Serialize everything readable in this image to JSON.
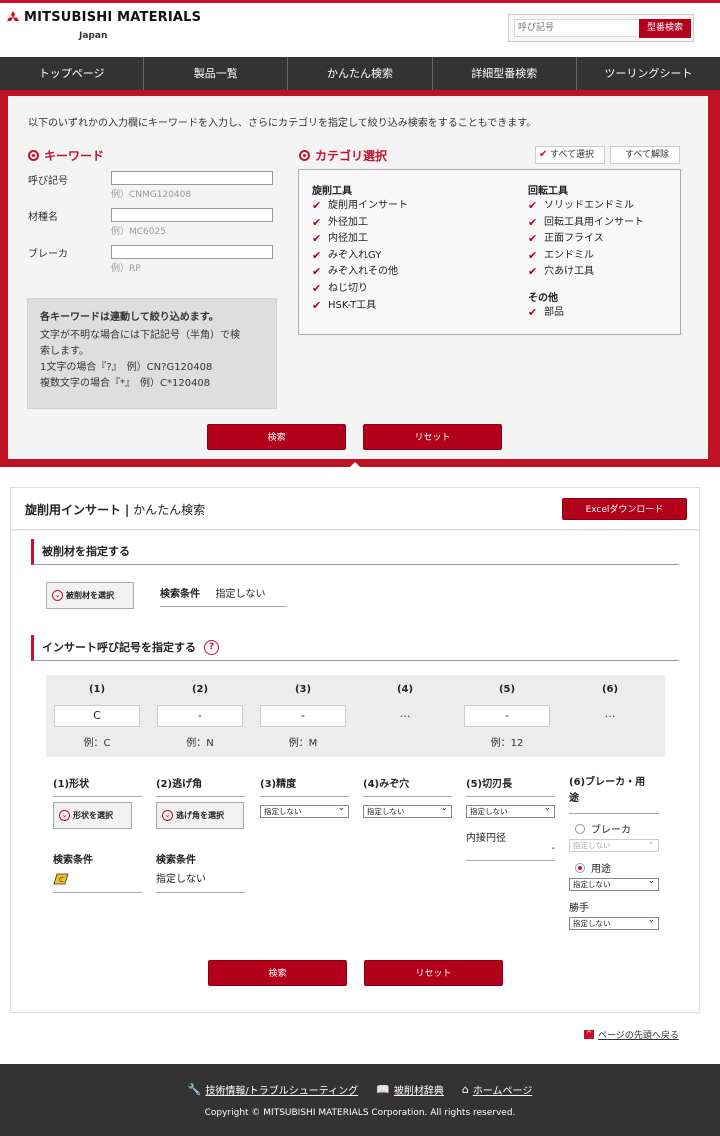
{
  "header": {
    "logo_text": "MITSUBISHI MATERIALS",
    "logo_sub": "Japan",
    "search_placeholder": "呼び記号",
    "search_button": "型番検索"
  },
  "nav": [
    "トップページ",
    "製品一覧",
    "かんたん検索",
    "詳細型番検索",
    "ツーリングシート"
  ],
  "search_panel": {
    "intro": "以下のいずれかの入力欄にキーワードを入力し、さらにカテゴリを指定して絞り込み検索をすることもできます。",
    "keyword_heading": "キーワード",
    "fields": [
      {
        "label": "呼び記号",
        "example": "例）CNMG120408"
      },
      {
        "label": "材種名",
        "example": "例）MC6025"
      },
      {
        "label": "ブレーカ",
        "example": "例）RP"
      }
    ],
    "note": {
      "title": "各キーワードは連動して絞り込めます。",
      "line1": "文字が不明な場合には下記記号（半角）で検",
      "line2": "索します。",
      "line3": "1文字の場合『?』　例）CN?G120408",
      "line4": "複数文字の場合『*』　例）C*120408"
    },
    "category_heading": "カテゴリ選択",
    "select_all": "すべて選択",
    "deselect_all": "すべて解除",
    "turning_title": "旋削工具",
    "turning_items": [
      "旋削用インサート",
      "外径加工",
      "内径加工",
      "みぞ入れGY",
      "みぞ入れその他",
      "ねじ切り",
      "HSK-T工具"
    ],
    "rotating_title": "回転工具",
    "rotating_items": [
      "ソリッドエンドミル",
      "回転工具用インサート",
      "正面フライス",
      "エンドミル",
      "穴あけ工具"
    ],
    "other_title": "その他",
    "other_items": [
      "部品"
    ],
    "search_button": "検索",
    "reset_button": "リセット"
  },
  "results": {
    "title_bold": "旋削用インサート",
    "title_sep": "|",
    "title_rest": "かんたん検索",
    "excel_button": "Excelダウンロード",
    "work_heading": "被削材を指定する",
    "work_select_button": "被削材を選択",
    "work_cond_label": "検索条件",
    "work_cond_value": "指定しない",
    "insert_heading": "インサート呼び記号を指定する",
    "help_icon": "?",
    "code_columns": [
      {
        "num": "(1)",
        "value": "C",
        "example": "例：C"
      },
      {
        "num": "(2)",
        "value": "-",
        "example": "例：N"
      },
      {
        "num": "(3)",
        "value": "-",
        "example": "例：M"
      },
      {
        "num": "(4)",
        "value": "…",
        "example": ""
      },
      {
        "num": "(5)",
        "value": "-",
        "example": "例：12"
      },
      {
        "num": "(6)",
        "value": "…",
        "example": ""
      }
    ],
    "f1_head": "(1)形状",
    "f1_button": "形状を選択",
    "f1_cond_label": "検索条件",
    "f1_cond_icon": "C",
    "f2_head": "(2)逃げ角",
    "f2_button": "逃げ角を選択",
    "f2_cond_label": "検索条件",
    "f2_cond_value": "指定しない",
    "f3_head": "(3)精度",
    "f3_select": "指定しない",
    "f4_head": "(4)みぞ穴",
    "f4_select": "指定しない",
    "f5_head": "(5)切刃長",
    "f5_select": "指定しない",
    "f5_sub_label": "内接円径",
    "f5_sub_value": "-",
    "f6_head_line1": "(6)ブレーカ・用",
    "f6_head_line2": "途",
    "f6_radio1": "ブレーカ",
    "f6_radio1_select": "指定しない",
    "f6_radio2": "用途",
    "f6_radio2_select": "指定しない",
    "f6_hand_label": "勝手",
    "f6_hand_select": "指定しない",
    "search_button": "検索",
    "reset_button": "リセット"
  },
  "page_top_link": "ページの先頭へ戻る",
  "footer": {
    "links": [
      "技術情報/トラブルシューティング",
      "被削材辞典",
      "ホームページ"
    ],
    "copyright": "Copyright © MITSUBISHI MATERIALS Corporation. All rights reserved."
  },
  "colors": {
    "brand_red": "#c8102e",
    "button_red": "#b3001b",
    "nav_bg": "#333333"
  }
}
